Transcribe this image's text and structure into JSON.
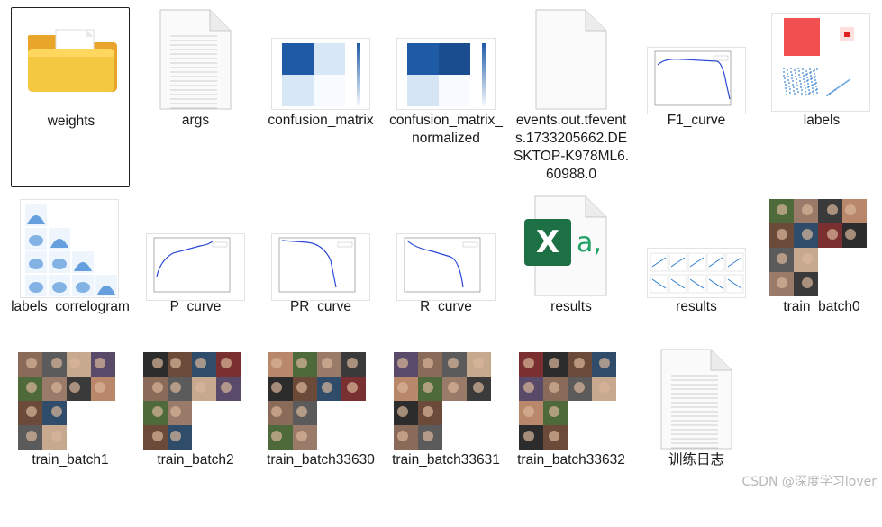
{
  "files": [
    {
      "id": "weights",
      "label": "weights",
      "kind": "folder",
      "selected": true
    },
    {
      "id": "args",
      "label": "args",
      "kind": "text"
    },
    {
      "id": "confusion-matrix",
      "label": "confusion_matrix",
      "kind": "matrix"
    },
    {
      "id": "confusion-matrix-normalized",
      "label": "confusion_matrix_normalized",
      "kind": "matrix"
    },
    {
      "id": "events",
      "label": "events.out.tfevents.1733205662.DESKTOP-K978ML6.60988.0",
      "kind": "blank"
    },
    {
      "id": "f1-curve",
      "label": "F1_curve",
      "kind": "curve"
    },
    {
      "id": "labels",
      "label": "labels",
      "kind": "labels"
    },
    {
      "id": "labels-correlogram",
      "label": "labels_correlogram",
      "kind": "correlogram"
    },
    {
      "id": "p-curve",
      "label": "P_curve",
      "kind": "curve"
    },
    {
      "id": "pr-curve",
      "label": "PR_curve",
      "kind": "curve"
    },
    {
      "id": "r-curve",
      "label": "R_curve",
      "kind": "curve"
    },
    {
      "id": "results-csv",
      "label": "results",
      "kind": "excel"
    },
    {
      "id": "results-png",
      "label": "results",
      "kind": "grid"
    },
    {
      "id": "train-batch0",
      "label": "train_batch0",
      "kind": "batch"
    },
    {
      "id": "train-batch1",
      "label": "train_batch1",
      "kind": "batch"
    },
    {
      "id": "train-batch2",
      "label": "train_batch2",
      "kind": "batch"
    },
    {
      "id": "train-batch33630",
      "label": "train_batch33630",
      "kind": "batch"
    },
    {
      "id": "train-batch33631",
      "label": "train_batch33631",
      "kind": "batch"
    },
    {
      "id": "train-batch33632",
      "label": "train_batch33632",
      "kind": "batch"
    },
    {
      "id": "training-log",
      "label": "训练日志",
      "kind": "text"
    }
  ],
  "excel_icon": {
    "letter": "X",
    "suffix": "a,"
  },
  "colors": {
    "excel_green": "#1d7044",
    "excel_accent": "#21a366",
    "folder_yellow": "#f5c842",
    "matrix_blue": "#1f5aa6",
    "curve_blue": "#2a49d6"
  },
  "watermark": "CSDN @深度学习lover"
}
